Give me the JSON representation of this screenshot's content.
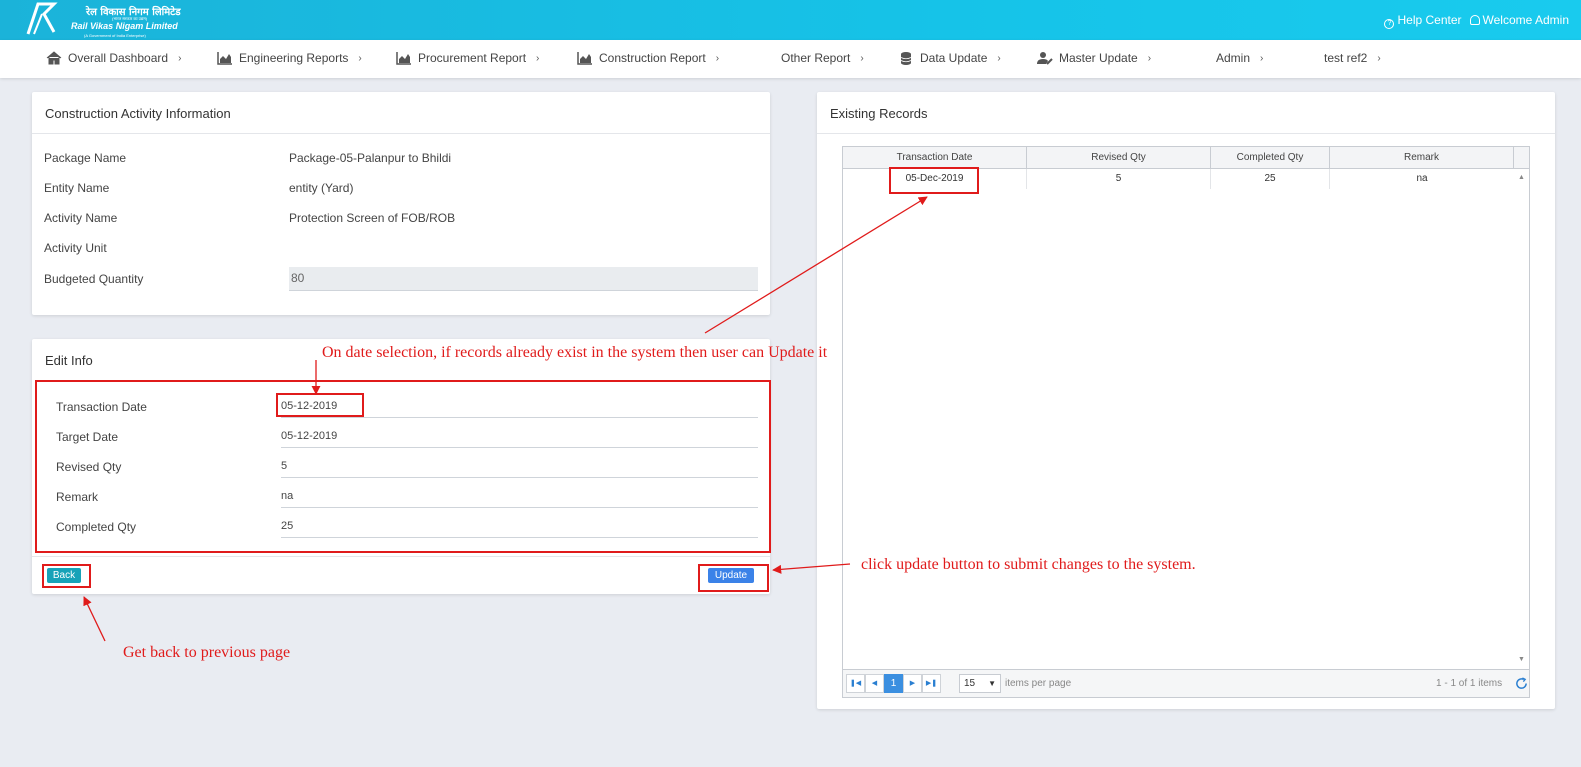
{
  "brand": {
    "hindi_name": "रेल विकास निगम लिमिटेड",
    "sub_hindi": "(भारत सरकार का उद्यम)",
    "english_name": "Rail Vikas Nigam Limited",
    "sub_english": "(A Government of India Enterprise)"
  },
  "header": {
    "help_center": "Help Center",
    "welcome": "Welcome Admin"
  },
  "nav": [
    {
      "label": "Overall Dashboard",
      "icon": "home-icon"
    },
    {
      "label": "Engineering Reports",
      "icon": "area-chart-icon"
    },
    {
      "label": "Procurement Report",
      "icon": "area-chart-icon"
    },
    {
      "label": "Construction Report",
      "icon": "area-chart-icon"
    },
    {
      "label": "Other Report",
      "icon": ""
    },
    {
      "label": "Data Update",
      "icon": "database-icon"
    },
    {
      "label": "Master Update",
      "icon": "user-edit-icon"
    },
    {
      "label": "Admin",
      "icon": ""
    },
    {
      "label": "test ref2",
      "icon": ""
    }
  ],
  "activity_card": {
    "title": "Construction Activity Information",
    "rows": [
      {
        "label": "Package Name",
        "value": "Package-05-Palanpur to Bhildi"
      },
      {
        "label": "Entity Name",
        "value": "entity (Yard)"
      },
      {
        "label": "Activity Name",
        "value": "Protection Screen of FOB/ROB"
      },
      {
        "label": "Activity Unit",
        "value": ""
      },
      {
        "label": "Budgeted Quantity",
        "value": "80"
      }
    ]
  },
  "edit_card": {
    "title": "Edit Info",
    "fields": [
      {
        "label": "Transaction Date",
        "value": "05-12-2019"
      },
      {
        "label": "Target Date",
        "value": "05-12-2019"
      },
      {
        "label": "Revised Qty",
        "value": "5"
      },
      {
        "label": "Remark",
        "value": "na"
      },
      {
        "label": "Completed Qty",
        "value": "25"
      }
    ],
    "back_label": "Back",
    "update_label": "Update"
  },
  "records_card": {
    "title": "Existing Records",
    "columns": [
      "Transaction Date",
      "Revised Qty",
      "Completed Qty",
      "Remark"
    ],
    "rows": [
      [
        "05-Dec-2019",
        "5",
        "25",
        "na"
      ]
    ],
    "pager": {
      "current_page": "1",
      "page_size": "15",
      "items_per_page_label": "items per page",
      "summary": "1 - 1 of 1 items"
    }
  },
  "annotations": {
    "date_selection": "On date selection, if records already exist in the system then user can Update it",
    "update_hint": "click update button to submit changes to the system.",
    "back_hint": "Get back to previous page"
  },
  "colors": {
    "topbar": "#16c3e8",
    "back_button": "#17a2b8",
    "update_button": "#3b82e8",
    "annotation": "#e01b1b"
  }
}
